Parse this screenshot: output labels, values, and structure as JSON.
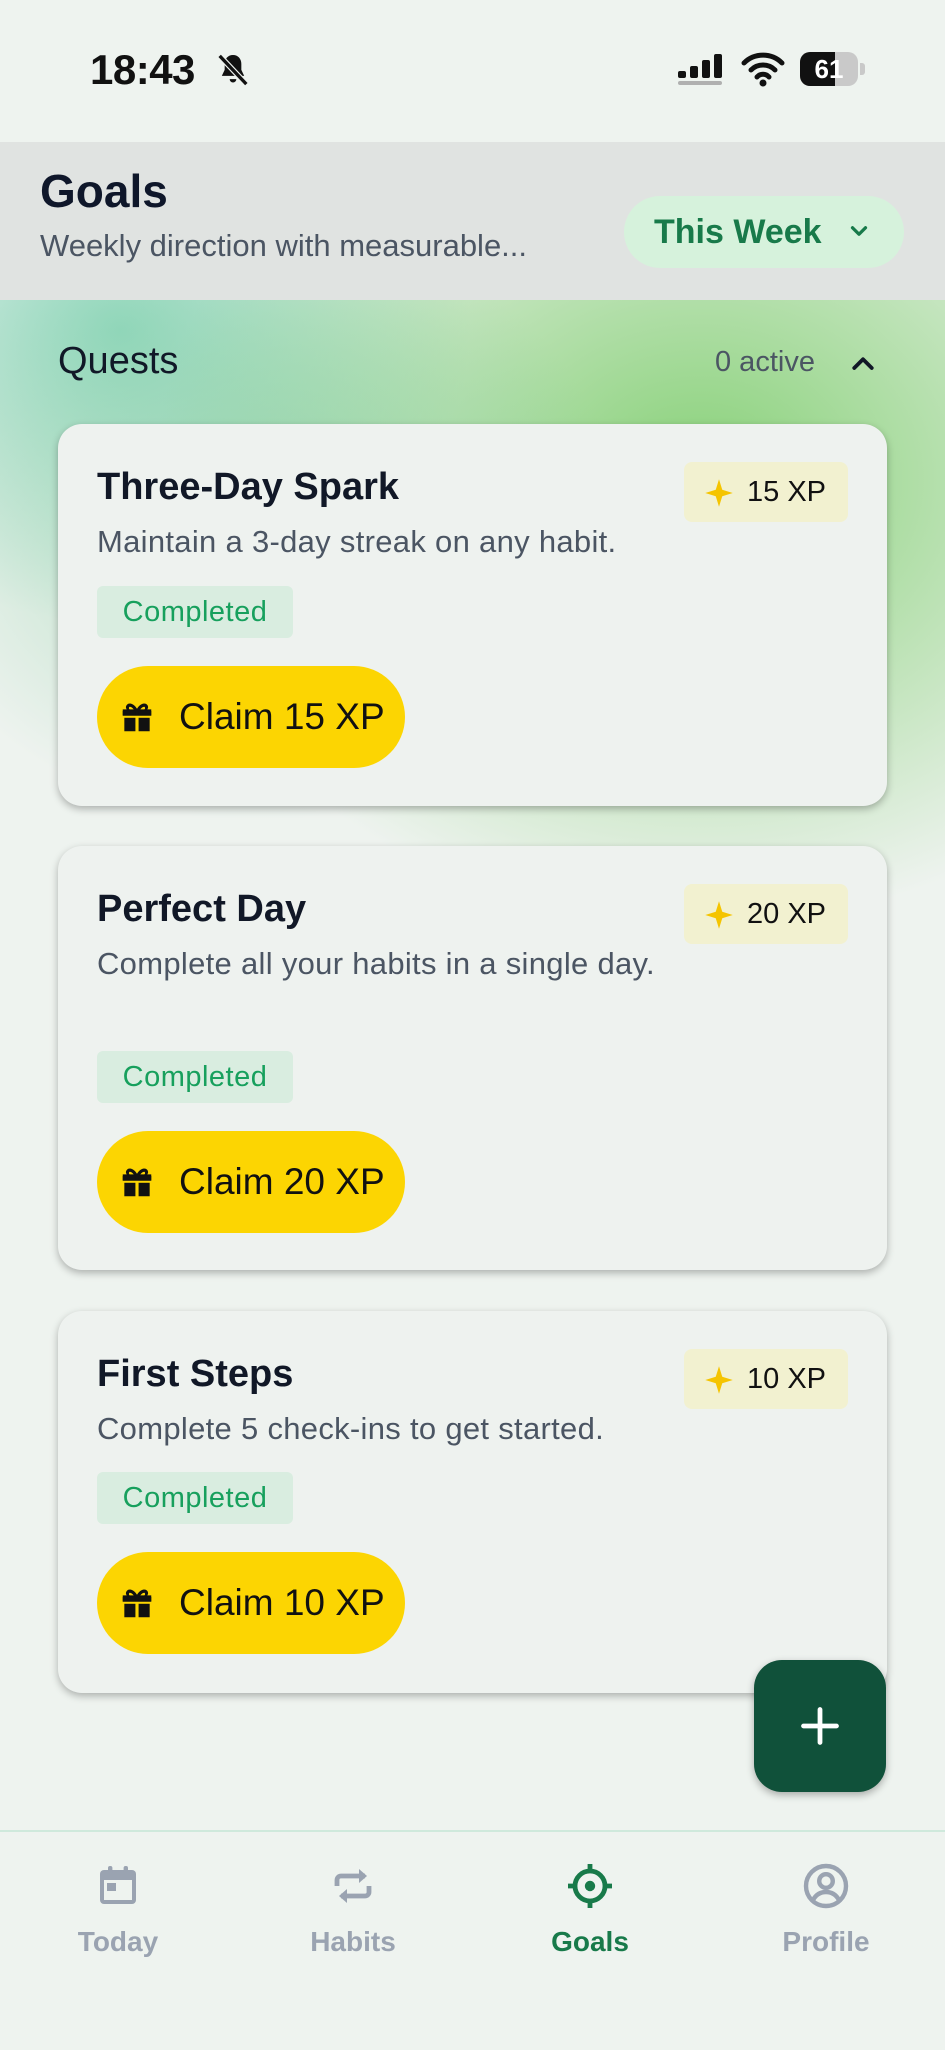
{
  "status_bar": {
    "time": "18:43",
    "battery": "61",
    "battery_level": 0.61
  },
  "header": {
    "title": "Goals",
    "subtitle": "Weekly direction with measurable...",
    "period_selector": "This Week"
  },
  "section": {
    "title": "Quests",
    "count": "0 active"
  },
  "quests": [
    {
      "name": "Three-Day Spark",
      "description": "Maintain a 3-day streak on any habit.",
      "xp": "15 XP",
      "status": "Completed",
      "claim_label": "Claim 15 XP"
    },
    {
      "name": "Perfect Day",
      "description": "Complete all your habits in a single day.",
      "xp": "20 XP",
      "status": "Completed",
      "claim_label": "Claim 20 XP"
    },
    {
      "name": "First Steps",
      "description": "Complete 5 check-ins to get started.",
      "xp": "10 XP",
      "status": "Completed",
      "claim_label": "Claim 10 XP"
    }
  ],
  "fab": {
    "icon": "plus-icon"
  },
  "bottom_nav": {
    "items": [
      {
        "label": "Today",
        "icon": "calendar-icon"
      },
      {
        "label": "Habits",
        "icon": "repeat-icon"
      },
      {
        "label": "Goals",
        "icon": "target-icon",
        "active": true
      },
      {
        "label": "Profile",
        "icon": "user-circle-icon"
      }
    ]
  },
  "colors": {
    "accent": "#187a4a",
    "claim_button": "#fcd502",
    "fab": "#10513a",
    "completed_text": "#17a05d",
    "nav_inactive": "#9aa3b1"
  }
}
